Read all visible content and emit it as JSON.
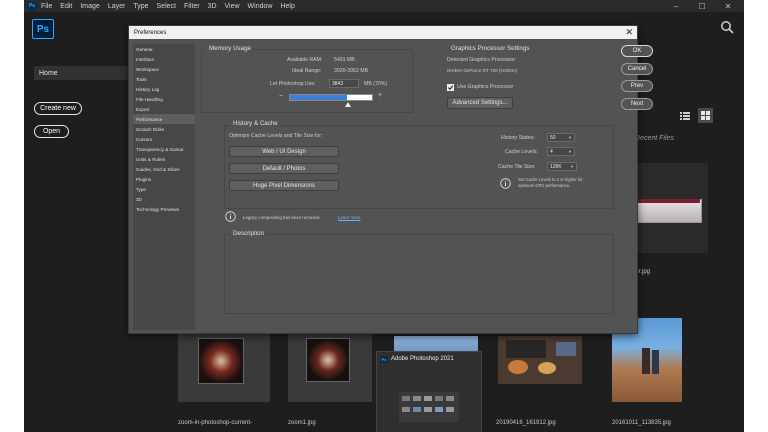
{
  "app": {
    "logo_mini": "Ps",
    "logo": "Ps",
    "menu": [
      "File",
      "Edit",
      "Image",
      "Layer",
      "Type",
      "Select",
      "Filter",
      "3D",
      "View",
      "Window",
      "Help"
    ],
    "window_controls": [
      "–",
      "☐",
      "✕"
    ]
  },
  "home": {
    "home_label": "Home",
    "create_new": "Create new",
    "open": "Open",
    "recent_files_title": "Recent Files",
    "files": [
      "zoom-in-photoshop-current-",
      "zoom1.jpg",
      "20190416_161912.jpg",
      "20161011_113835.jpg",
      "ler.jpg"
    ],
    "splash_title": "Adobe Photoshop 2021"
  },
  "dialog": {
    "title": "Preferences",
    "close": "✕",
    "nav": [
      "General",
      "Interface",
      "Workspace",
      "Tools",
      "History Log",
      "File Handling",
      "Export",
      "Performance",
      "Scratch Disks",
      "Cursors",
      "Transparency & Gamut",
      "Units & Rulers",
      "Guides, Grid & Slices",
      "Plugins",
      "Type",
      "3D",
      "Technology Previews"
    ],
    "selected_nav": "Performance",
    "memory": {
      "title": "Memory Usage",
      "available_label": "Available RAM:",
      "available_value": "5491 MB",
      "ideal_label": "Ideal Range:",
      "ideal_value": "3020-3953 MB",
      "let_label": "Let Photoshop Use:",
      "let_value": "3843",
      "let_suffix": "MB (70%)",
      "minus": "−",
      "plus": "+",
      "slider_fraction": 0.7
    },
    "gpu": {
      "title": "Graphics Processor Settings",
      "detected_label": "Detected Graphics Processor:",
      "detected_value": "NVIDIA GeForce GT 750 (NVIDIA)",
      "use_label": "Use Graphics Processor",
      "use_checked": true,
      "advanced_button": "Advanced Settings..."
    },
    "history": {
      "title": "History & Cache",
      "optimize_label": "Optimize Cache Levels and Tile Size for:",
      "buttons": [
        "Web / UI Design",
        "Default / Photos",
        "Huge Pixel Dimensions"
      ],
      "states_label": "History States:",
      "states_value": "50",
      "levels_label": "Cache Levels:",
      "levels_value": "4",
      "tile_label": "Cache Tile Size:",
      "tile_value": "128K",
      "info_text_1": "Set Cache Levels to 2 or higher for",
      "info_text_2": "optimum GPU performance."
    },
    "legacy_text": "Legacy compositing has been removed",
    "learn_more": "Learn more",
    "description_title": "Description",
    "buttons": {
      "ok": "OK",
      "cancel": "Cancel",
      "prev": "Prev",
      "next": "Next"
    }
  },
  "colors": {
    "accent": "#31a8ff",
    "slider_fill": "#3d7fd4",
    "dialog_bg": "#535353",
    "app_bg": "#1e1e1e"
  }
}
